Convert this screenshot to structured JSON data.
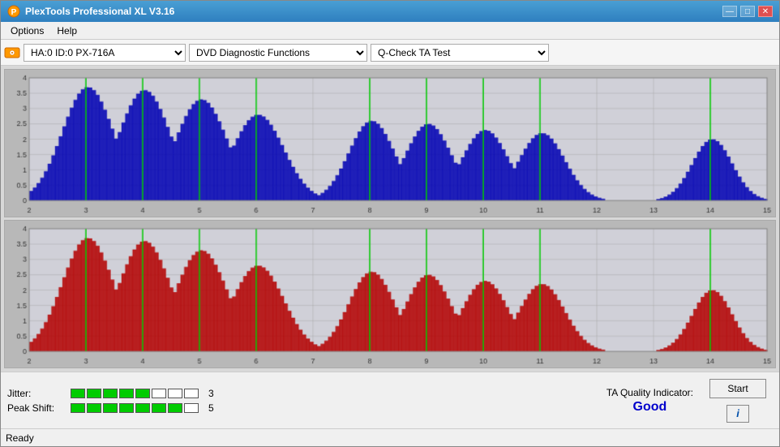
{
  "titleBar": {
    "title": "PlexTools Professional XL V3.16",
    "icon": "plex-icon",
    "controls": {
      "minimize": "—",
      "maximize": "□",
      "close": "✕"
    }
  },
  "menuBar": {
    "items": [
      "Options",
      "Help"
    ]
  },
  "toolbar": {
    "deviceIcon": "disc-drive-icon",
    "deviceValue": "HA:0 ID:0  PX-716A",
    "functionValue": "DVD Diagnostic Functions",
    "testValue": "Q-Check TA Test"
  },
  "charts": {
    "topChart": {
      "label": "top-chart",
      "yMax": 4,
      "yLabels": [
        "4",
        "3.5",
        "3",
        "2.5",
        "2",
        "1.5",
        "1",
        "0.5",
        "0"
      ],
      "xLabels": [
        "2",
        "3",
        "4",
        "5",
        "6",
        "7",
        "8",
        "9",
        "10",
        "11",
        "12",
        "13",
        "14",
        "15"
      ],
      "color": "#0000cc"
    },
    "bottomChart": {
      "label": "bottom-chart",
      "yMax": 4,
      "yLabels": [
        "4",
        "3.5",
        "3",
        "2.5",
        "2",
        "1.5",
        "1",
        "0.5",
        "0"
      ],
      "xLabels": [
        "2",
        "3",
        "4",
        "5",
        "6",
        "7",
        "8",
        "9",
        "10",
        "11",
        "12",
        "13",
        "14",
        "15"
      ],
      "color": "#cc0000"
    }
  },
  "bottomPanel": {
    "jitter": {
      "label": "Jitter:",
      "filledBlocks": 5,
      "totalBlocks": 8,
      "value": "3"
    },
    "peakShift": {
      "label": "Peak Shift:",
      "filledBlocks": 7,
      "totalBlocks": 8,
      "value": "5"
    },
    "taQuality": {
      "label": "TA Quality Indicator:",
      "value": "Good"
    },
    "startButton": "Start",
    "infoButton": "i"
  },
  "statusBar": {
    "text": "Ready"
  }
}
